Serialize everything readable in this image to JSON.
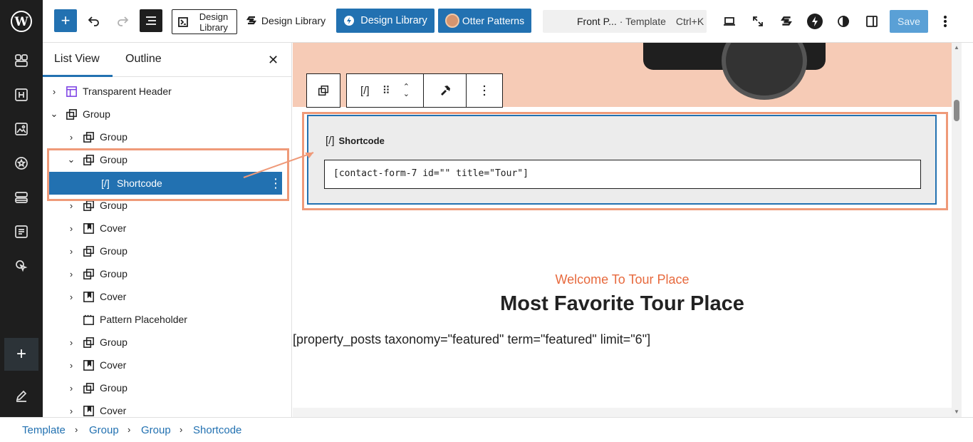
{
  "toolbar": {
    "design_library_label": "Design Library",
    "design_library_label_2": "Design Library",
    "design_library_label_3": "Design Library",
    "otter_patterns_label": "Otter Patterns",
    "command_title": "Front P...",
    "command_type": "· Template",
    "command_shortcut": "Ctrl+K",
    "save_label": "Save"
  },
  "list_view": {
    "tab_list": "List View",
    "tab_outline": "Outline",
    "items": [
      {
        "label": "Transparent Header"
      },
      {
        "label": "Group"
      },
      {
        "label": "Group"
      },
      {
        "label": "Group"
      },
      {
        "label": "Shortcode"
      },
      {
        "label": "Group"
      },
      {
        "label": "Cover"
      },
      {
        "label": "Group"
      },
      {
        "label": "Group"
      },
      {
        "label": "Cover"
      },
      {
        "label": "Pattern Placeholder"
      },
      {
        "label": "Group"
      },
      {
        "label": "Cover"
      },
      {
        "label": "Group"
      },
      {
        "label": "Cover"
      }
    ]
  },
  "canvas": {
    "shortcode_label": "Shortcode",
    "shortcode_icon_text": "[/]",
    "shortcode_value": "[contact-form-7 id=\"\" title=\"Tour\"]",
    "welcome": "Welcome To Tour Place",
    "heading": "Most Favorite Tour Place",
    "property_shortcode": "[property_posts taxonomy=\"featured\" term=\"featured\" limit=\"6\"]"
  },
  "breadcrumb": [
    "Template",
    "Group",
    "Group",
    "Shortcode"
  ],
  "colors": {
    "accent": "#2271b1",
    "callout": "#ef9a79",
    "welcome": "#e7693d",
    "hero": "#f6cbb6"
  }
}
